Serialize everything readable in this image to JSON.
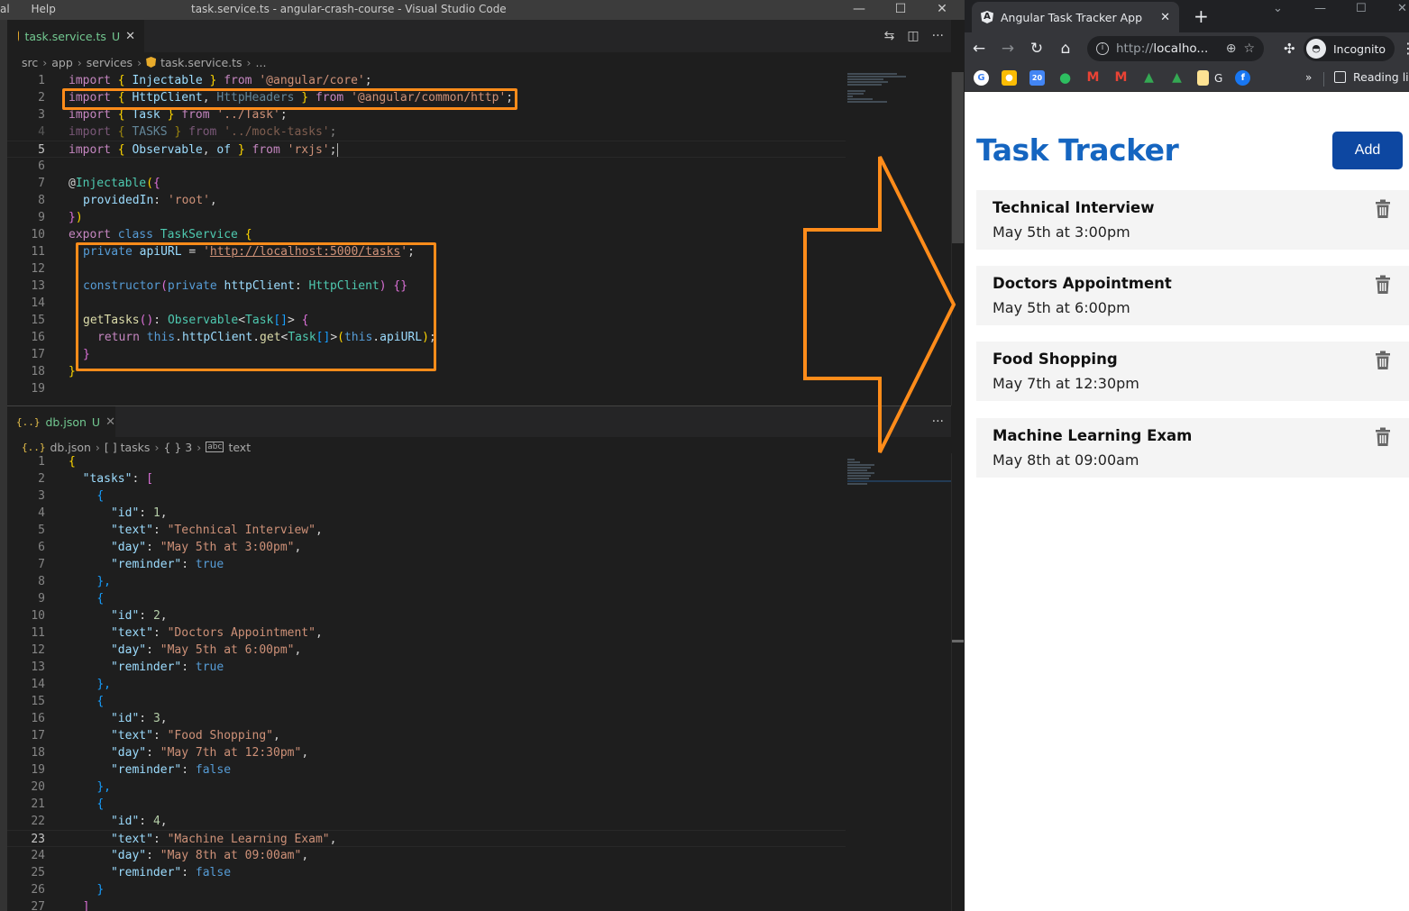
{
  "vscode": {
    "menu": [
      "al",
      "Help"
    ],
    "window_title": "task.service.ts - angular-crash-course - Visual Studio Code",
    "window_controls": {
      "minimize": "—",
      "maximize": "☐",
      "close": "✕"
    },
    "top_pane": {
      "tab": {
        "name": "task.service.ts",
        "status": "U",
        "close": "✕"
      },
      "tab_actions": {
        "compare": "⇆",
        "split": "◫",
        "more": "···"
      },
      "breadcrumb": [
        "src",
        "app",
        "services",
        "task.service.ts",
        "..."
      ],
      "lines": [
        {
          "n": "1"
        },
        {
          "n": "2"
        },
        {
          "n": "3"
        },
        {
          "n": "4"
        },
        {
          "n": "5"
        },
        {
          "n": "6"
        },
        {
          "n": "7"
        },
        {
          "n": "8"
        },
        {
          "n": "9"
        },
        {
          "n": "10"
        },
        {
          "n": "11"
        },
        {
          "n": "12"
        },
        {
          "n": "13"
        },
        {
          "n": "14"
        },
        {
          "n": "15"
        },
        {
          "n": "16"
        },
        {
          "n": "17"
        },
        {
          "n": "18"
        },
        {
          "n": "19"
        }
      ],
      "code": {
        "l1": [
          "import",
          " ",
          "{",
          " Injectable ",
          "}",
          " from ",
          "'@angular/core'",
          ";"
        ],
        "l2": [
          "import",
          " ",
          "{",
          " HttpClient",
          ", ",
          "HttpHeaders ",
          "}",
          " from ",
          "'@angular/common/http'",
          ";"
        ],
        "l3": [
          "import",
          " ",
          "{",
          " Task ",
          "}",
          " from ",
          "'../Task'",
          ";"
        ],
        "l4": [
          "import",
          " ",
          "{",
          " TASKS ",
          "}",
          " from ",
          "'../mock-tasks'",
          ";"
        ],
        "l5": [
          "import",
          " ",
          "{",
          " Observable",
          ", ",
          "of ",
          "}",
          " from ",
          "'rxjs'",
          ";"
        ],
        "l7": [
          "@",
          "Injectable",
          "(",
          "{"
        ],
        "l8": [
          "providedIn",
          ": ",
          "'root'",
          ","
        ],
        "l9": [
          "}",
          ")"
        ],
        "l10": [
          "export",
          " ",
          "class",
          " ",
          "TaskService",
          " ",
          "{"
        ],
        "l11": [
          "private",
          " ",
          "apiURL",
          " = ",
          "'",
          "http://localhost:5000/tasks",
          "'",
          ";"
        ],
        "l13": [
          "constructor",
          "(",
          "private",
          " ",
          "httpClient",
          ": ",
          "HttpClient",
          ")",
          " ",
          "{}"
        ],
        "l15": [
          "getTasks",
          "()",
          ": ",
          "Observable",
          "<",
          "Task",
          "[]",
          ">",
          " ",
          "{"
        ],
        "l16": [
          "return",
          " ",
          "this",
          ".",
          "httpClient",
          ".",
          "get",
          "<",
          "Task",
          "[]",
          ">",
          "(",
          "this",
          ".",
          "apiURL",
          ")",
          ";"
        ],
        "l17": [
          "}"
        ],
        "l18": [
          "}"
        ]
      }
    },
    "bottom_pane": {
      "tab": {
        "icon": "{..}",
        "name": "db.json",
        "status": "U",
        "close": "✕"
      },
      "more": "···",
      "breadcrumb": [
        "db.json",
        "[ ] tasks",
        "{ } 3",
        "text"
      ],
      "line_numbers": [
        "1",
        "2",
        "3",
        "4",
        "5",
        "6",
        "7",
        "8",
        "9",
        "10",
        "11",
        "12",
        "13",
        "14",
        "15",
        "16",
        "17",
        "18",
        "19",
        "20",
        "21",
        "22",
        "23",
        "24",
        "25",
        "26",
        "27"
      ],
      "tasks_key": "\"tasks\"",
      "tasks": [
        {
          "id": "1",
          "text": "\"Technical Interview\"",
          "day": "\"May 5th at 3:00pm\"",
          "reminder": "true"
        },
        {
          "id": "2",
          "text": "\"Doctors Appointment\"",
          "day": "\"May 5th at 6:00pm\"",
          "reminder": "true"
        },
        {
          "id": "3",
          "text": "\"Food Shopping\"",
          "day": "\"May 7th at 12:30pm\"",
          "reminder": "false"
        },
        {
          "id": "4",
          "text": "\"Machine Learning Exam\"",
          "day": "\"May 8th at 09:00am\"",
          "reminder": "false"
        }
      ],
      "keys": {
        "id": "\"id\"",
        "text": "\"text\"",
        "day": "\"day\"",
        "reminder": "\"reminder\""
      }
    }
  },
  "browser": {
    "tab_title": "Angular Task Tracker App",
    "tab_close": "✕",
    "new_tab": "+",
    "window_controls": {
      "dropdown": "⌄",
      "minimize": "—",
      "maximize": "☐",
      "close": "✕"
    },
    "url_protocol": "http://",
    "url_rest": "localho...",
    "profile_label": "Incognito",
    "bookmarks_more": "»",
    "reading_list": "Reading list",
    "bookmark_letters": {
      "g_text": "G",
      "calendar": "20"
    }
  },
  "app": {
    "title": "Task Tracker",
    "add_label": "Add",
    "accent_color": "#1565c0",
    "button_color": "#0d47a1",
    "tasks": [
      {
        "text": "Technical Interview",
        "day": "May 5th at 3:00pm"
      },
      {
        "text": "Doctors Appointment",
        "day": "May 5th at 6:00pm"
      },
      {
        "text": "Food Shopping",
        "day": "May 7th at 12:30pm"
      },
      {
        "text": "Machine Learning Exam",
        "day": "May 8th at 09:00am"
      }
    ]
  },
  "annotations": {
    "highlight_color": "#ff8c1a"
  }
}
